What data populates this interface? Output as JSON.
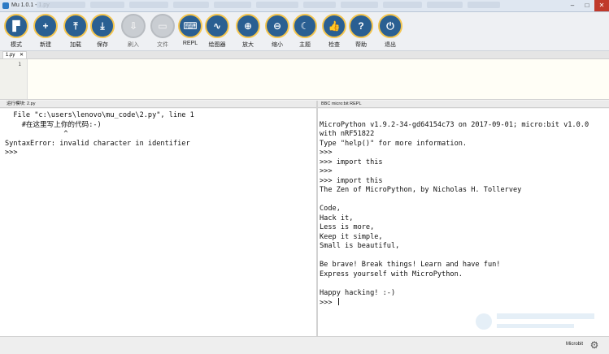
{
  "window": {
    "title": "Mu 1.0.1 - 1.py"
  },
  "toolbar": [
    {
      "name": "mode-button",
      "icon": "mode-icon",
      "glyph": "▛",
      "label": "模式",
      "dim": false
    },
    {
      "name": "new-button",
      "icon": "plus-icon",
      "glyph": "+",
      "label": "新建",
      "dim": false
    },
    {
      "name": "load-button",
      "icon": "upload-icon",
      "glyph": "⤒",
      "label": "加载",
      "dim": false
    },
    {
      "name": "save-button",
      "icon": "download-icon",
      "glyph": "⤓",
      "label": "保存",
      "dim": false
    },
    {
      "name": "flash-button",
      "icon": "flash-icon",
      "glyph": "⇩",
      "label": "刷入",
      "dim": true
    },
    {
      "name": "files-button",
      "icon": "files-icon",
      "glyph": "▭",
      "label": "文件",
      "dim": true
    },
    {
      "name": "repl-button",
      "icon": "keyboard-icon",
      "glyph": "⌨",
      "label": "REPL",
      "dim": false
    },
    {
      "name": "plotter-button",
      "icon": "pulse-icon",
      "glyph": "∿",
      "label": "绘图器",
      "dim": false
    },
    {
      "name": "zoom-in-button",
      "icon": "zoom-in-icon",
      "glyph": "⊕",
      "label": "放大",
      "dim": false
    },
    {
      "name": "zoom-out-button",
      "icon": "zoom-out-icon",
      "glyph": "⊖",
      "label": "缩小",
      "dim": false
    },
    {
      "name": "theme-button",
      "icon": "moon-icon",
      "glyph": "☾",
      "label": "主题",
      "dim": false
    },
    {
      "name": "check-button",
      "icon": "thumbs-up-icon",
      "glyph": "👍",
      "label": "检查",
      "dim": false
    },
    {
      "name": "help-button",
      "icon": "question-icon",
      "glyph": "?",
      "label": "帮助",
      "dim": false
    },
    {
      "name": "quit-button",
      "icon": "power-icon",
      "glyph": "⏻",
      "label": "退出",
      "dim": false
    }
  ],
  "editor": {
    "tab_label": "1.py",
    "tab_close": "✕",
    "line_numbers": [
      "1"
    ]
  },
  "left_pane": {
    "header": "运行模块: 2.py",
    "lines": [
      "  File \"c:\\users\\lenovo\\mu_code\\2.py\", line 1",
      "    #在这里写上你的代码:-)",
      "              ^",
      "SyntaxError: invalid character in identifier",
      ">>> "
    ]
  },
  "right_pane": {
    "header": "BBC micro:bit REPL",
    "lines": [
      "",
      "MicroPython v1.9.2-34-gd64154c73 on 2017-09-01; micro:bit v1.0.0",
      "with nRF51822",
      "Type \"help()\" for more information.",
      ">>> ",
      ">>> import this",
      ">>> ",
      ">>> import this",
      "The Zen of MicroPython, by Nicholas H. Tollervey",
      "",
      "Code,",
      "Hack it,",
      "Less is more,",
      "Keep it simple,",
      "Small is beautiful,",
      "",
      "Be brave! Break things! Learn and have fun!",
      "Express yourself with MicroPython.",
      "",
      "Happy hacking! :-)"
    ],
    "prompt": ">>> "
  },
  "status": {
    "mode": "Microbit",
    "settings_icon": "gear-icon"
  },
  "colors": {
    "button_fill": "#2a5f92",
    "button_ring": "#f4c54e",
    "editor_bg": "#fffef6"
  }
}
